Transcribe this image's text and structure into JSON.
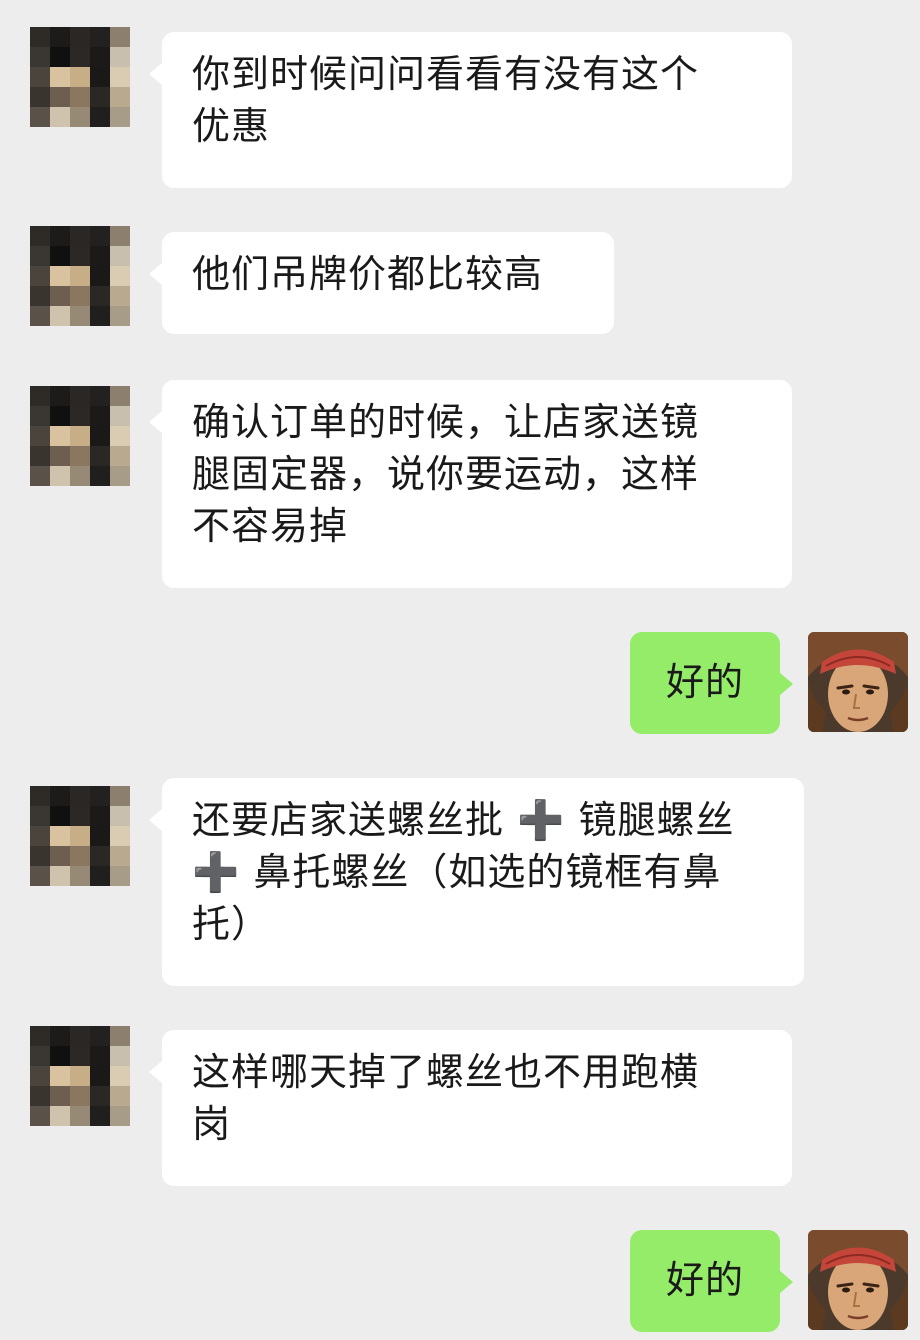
{
  "messages": [
    {
      "side": "in",
      "text": "你到时候问问看看有没有这个\n优惠"
    },
    {
      "side": "in",
      "text": "他们吊牌价都比较高"
    },
    {
      "side": "in",
      "text": "确认订单的时候，让店家送镜\n腿固定器，说你要运动，这样\n不容易掉"
    },
    {
      "side": "out",
      "text": "好的"
    },
    {
      "side": "in",
      "text": "还要店家送螺丝批 ➕ 镜腿螺丝\n➕ 鼻托螺丝（如选的镜框有鼻\n托）"
    },
    {
      "side": "in",
      "text": "这样哪天掉了螺丝也不用跑横\n岗"
    },
    {
      "side": "out",
      "text": "好的"
    }
  ],
  "avatars": {
    "contact": "pixelated-contact-avatar",
    "self": "cartoon-character-avatar"
  },
  "colors": {
    "background": "#ededed",
    "incoming_bubble": "#ffffff",
    "outgoing_bubble": "#95ec69"
  }
}
